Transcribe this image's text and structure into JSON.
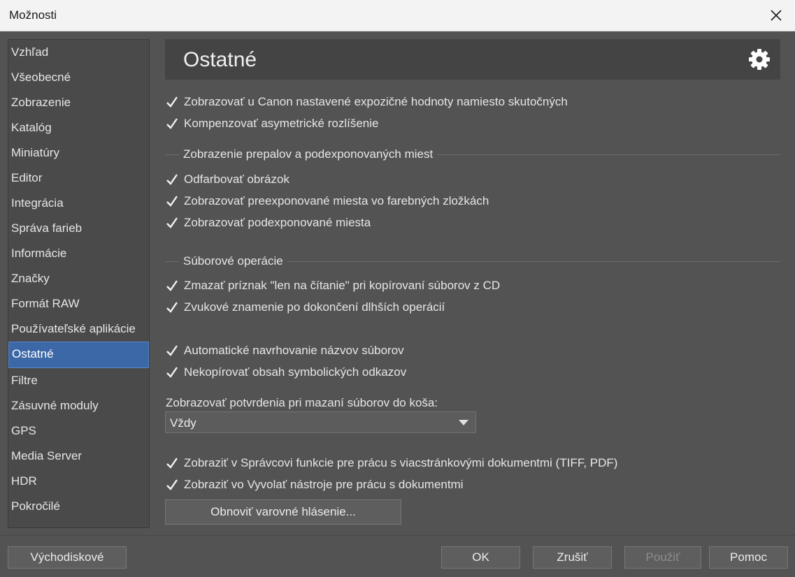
{
  "window": {
    "title": "Možnosti"
  },
  "sidebar": {
    "items": [
      {
        "label": "Vzhľad"
      },
      {
        "label": "Všeobecné"
      },
      {
        "label": "Zobrazenie"
      },
      {
        "label": "Katalóg"
      },
      {
        "label": "Miniatúry"
      },
      {
        "label": "Editor"
      },
      {
        "label": "Integrácia"
      },
      {
        "label": "Správa farieb"
      },
      {
        "label": "Informácie"
      },
      {
        "label": "Značky"
      },
      {
        "label": "Formát RAW"
      },
      {
        "label": "Používateľské aplikácie"
      },
      {
        "label": "Ostatné",
        "active": true
      },
      {
        "label": "Filtre"
      },
      {
        "label": "Zásuvné moduly"
      },
      {
        "label": "GPS"
      },
      {
        "label": "Media Server"
      },
      {
        "label": "HDR"
      },
      {
        "label": "Pokročilé"
      }
    ]
  },
  "header": {
    "title": "Ostatné",
    "icon": "gear-icon"
  },
  "options": {
    "canon_exposure": "Zobrazovať u Canon nastavené expozičné hodnoty namiesto skutočných",
    "asym_resolution": "Kompenzovať asymetrické rozlíšenie",
    "section_clipping": "Zobrazenie prepalov a podexponovaných miest",
    "desaturate": "Odfarbovať obrázok",
    "overexposed_channels": "Zobrazovať preexponované miesta vo farebných zložkách",
    "underexposed": "Zobrazovať podexponované miesta",
    "section_files": "Súborové operácie",
    "remove_readonly": "Zmazať príznak \"len na čítanie\" pri kopírovaní súborov z CD",
    "sound_done": "Zvukové znamenie po dokončení dlhších operácií",
    "auto_filename": "Automatické navrhovanie názvov súborov",
    "no_copy_symlinks": "Nekopírovať obsah symbolických odkazov",
    "confirm_label": "Zobrazovať potvrdenia pri mazaní súborov do koša:",
    "confirm_value": "Vždy",
    "multipage_manager": "Zobraziť v Správcovi funkcie pre prácu s viacstránkovými dokumentmi (TIFF, PDF)",
    "develop_docs": "Zobraziť vo Vyvolať nástroje pre prácu s dokumentmi",
    "reset_warnings": "Obnoviť varovné hlásenie..."
  },
  "footer": {
    "defaults": "Východiskové",
    "ok": "OK",
    "cancel": "Zrušiť",
    "apply": "Použiť",
    "help": "Pomoc"
  },
  "colors": {
    "accent": "#3d68a8",
    "background": "#535353"
  }
}
